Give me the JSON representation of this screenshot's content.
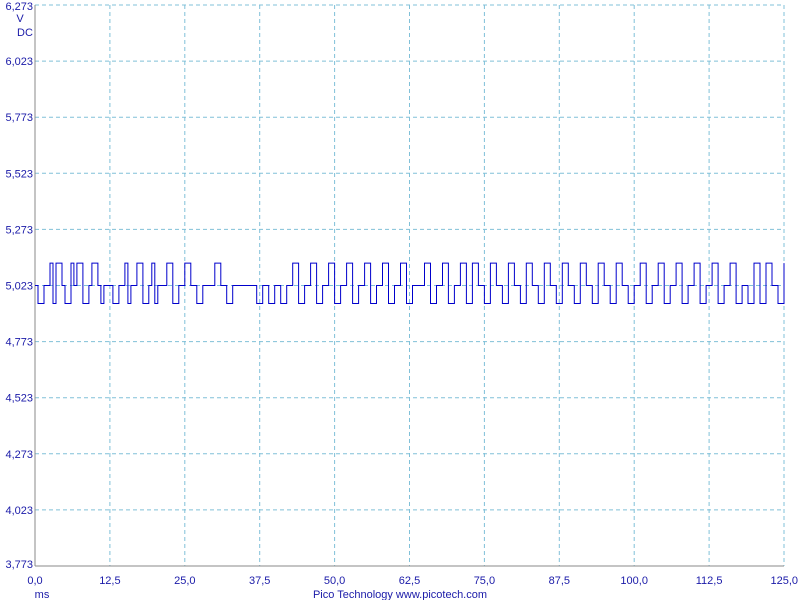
{
  "chart_data": {
    "type": "line",
    "units": {
      "y": "V",
      "coupling": "DC",
      "x": "ms"
    },
    "ylim": [
      3.773,
      6.273
    ],
    "xlim": [
      0,
      125
    ],
    "y_ticks": [
      "6,273",
      "6,023",
      "5,773",
      "5,523",
      "5,273",
      "5,023",
      "4,773",
      "4,523",
      "4,273",
      "4,023",
      "3,773"
    ],
    "x_ticks": [
      "0,0",
      "12,5",
      "25,0",
      "37,5",
      "50,0",
      "62,5",
      "75,0",
      "87,5",
      "100,0",
      "112,5",
      "125,0"
    ],
    "grid": true,
    "colors": {
      "trace": "#0000cc",
      "grid": "#80c0d8",
      "text": "#1a1aa8",
      "frame": "#888888"
    },
    "series": [
      {
        "baseline": 5.023,
        "high": 5.123,
        "low": 4.943,
        "x": [
          0,
          0.5,
          1.5,
          2.5,
          3,
          3.5,
          4.5,
          5,
          6,
          6.5,
          7,
          8,
          9,
          9.5,
          10.5,
          11,
          11.5,
          12,
          13,
          14,
          15,
          15.5,
          16,
          17,
          18,
          19,
          19.5,
          20,
          20.5,
          21,
          22,
          23,
          24,
          25,
          26,
          27,
          28,
          29,
          30,
          31,
          32,
          33,
          34,
          35,
          36,
          37,
          38,
          39,
          40,
          41,
          42,
          43,
          44,
          45,
          46,
          47,
          48,
          49,
          50,
          51,
          52,
          53,
          54,
          55,
          56,
          57,
          58,
          59,
          60,
          61,
          62,
          63,
          64,
          65,
          66,
          67,
          68,
          69,
          70,
          71,
          72,
          73,
          74,
          75,
          76,
          77,
          78,
          79,
          80,
          81,
          82,
          83,
          84,
          85,
          86,
          87,
          88,
          89,
          90,
          91,
          92,
          93,
          94,
          95,
          96,
          97,
          98,
          99,
          100,
          101,
          102,
          103,
          104,
          105,
          106,
          107,
          108,
          109,
          110,
          111,
          112,
          113,
          114,
          115,
          116,
          117,
          118,
          119,
          120,
          121,
          122,
          123,
          124,
          125
        ],
        "y": [
          5.023,
          4.943,
          5.023,
          5.123,
          4.943,
          5.123,
          5.023,
          4.943,
          5.123,
          5.023,
          5.123,
          4.943,
          5.023,
          5.123,
          5.023,
          4.943,
          5.023,
          5.023,
          4.943,
          5.023,
          5.123,
          4.943,
          5.023,
          5.123,
          4.943,
          5.023,
          5.123,
          4.943,
          5.023,
          5.023,
          5.123,
          4.943,
          5.023,
          5.123,
          5.023,
          4.943,
          5.023,
          5.023,
          5.123,
          5.023,
          4.943,
          5.023,
          5.023,
          5.023,
          5.023,
          4.943,
          5.023,
          4.943,
          5.023,
          4.943,
          5.023,
          5.123,
          4.943,
          5.023,
          5.123,
          4.943,
          5.023,
          5.123,
          4.943,
          5.023,
          5.123,
          4.943,
          5.023,
          5.123,
          4.943,
          5.023,
          5.123,
          4.943,
          5.023,
          5.123,
          4.943,
          5.023,
          5.023,
          5.123,
          4.943,
          5.023,
          5.123,
          4.943,
          5.023,
          5.123,
          4.943,
          5.123,
          5.023,
          4.943,
          5.123,
          5.023,
          4.943,
          5.123,
          5.023,
          4.943,
          5.123,
          5.023,
          4.943,
          5.123,
          5.023,
          4.943,
          5.123,
          5.023,
          4.943,
          5.123,
          5.023,
          4.943,
          5.123,
          5.023,
          4.943,
          5.123,
          5.023,
          4.943,
          5.023,
          5.123,
          4.943,
          5.023,
          5.123,
          4.943,
          5.023,
          5.123,
          4.943,
          5.023,
          5.123,
          4.943,
          5.023,
          5.123,
          4.943,
          5.023,
          5.123,
          4.943,
          5.023,
          4.943,
          5.123,
          4.943,
          5.123,
          5.023,
          4.943,
          5.123
        ]
      }
    ]
  },
  "footer": {
    "text": "Pico Technology  www.picotech.com"
  }
}
